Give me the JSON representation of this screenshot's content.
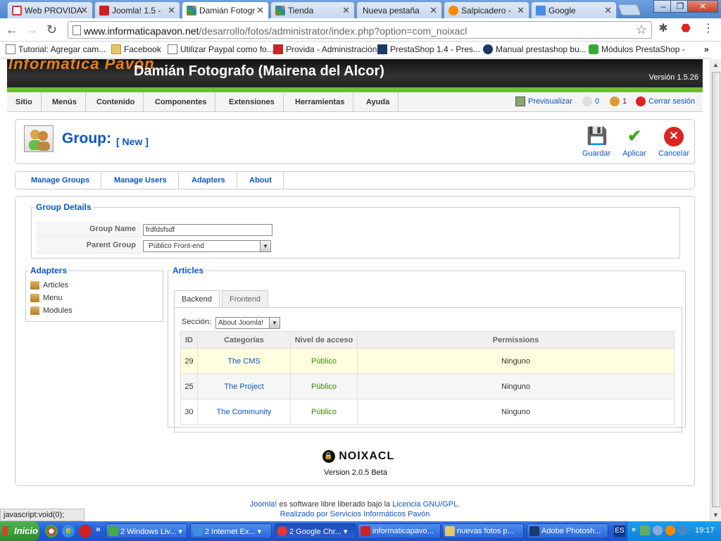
{
  "browser": {
    "tabs": [
      {
        "label": "Web PROVIDA",
        "color": "#d33"
      },
      {
        "label": "Joomla! 1.5 -",
        "color": "#c22"
      },
      {
        "label": "Damián Fotogr",
        "color": "#333",
        "active": true
      },
      {
        "label": "Tienda",
        "color": "#333"
      },
      {
        "label": "Nueva pestaña",
        "color": "#fff"
      },
      {
        "label": "Salpicadero -",
        "color": "#f80"
      },
      {
        "label": "Google",
        "color": "#4a8ae8"
      }
    ],
    "url_host": "www.informaticapavon.net",
    "url_path": "/desarrollo/fotos/administrator/index.php?option=com_noixacl",
    "bookmarks": [
      "Tutorial: Agregar cam...",
      "Facebook",
      "Utilizar Paypal como fo...",
      "Provida - Administración",
      "PrestaShop 1.4 - Pres...",
      "Manual prestashop bu...",
      "Módulos PrestaShop -"
    ],
    "bookmarks_more": "»"
  },
  "site": {
    "logo": "Informatica Pavón",
    "title": "Damián Fotografo (Mairena del Alcor)",
    "version": "Versión 1.5.26"
  },
  "menu": [
    "Sitio",
    "Menús",
    "Contenido",
    "Componentes",
    "Extensiones",
    "Herramientas",
    "Ayuda"
  ],
  "status": {
    "preview": "Previsualizar",
    "messages": "0",
    "users": "1",
    "logout": "Cerrar sesión"
  },
  "toolbar": {
    "title": "Group:",
    "subtitle": "[ New ]",
    "save": "Guardar",
    "apply": "Aplicar",
    "cancel": "Cancelar"
  },
  "submenu": [
    "Manage Groups",
    "Manage Users",
    "Adapters",
    "About"
  ],
  "group_details": {
    "legend": "Group Details",
    "name_label": "Group Name",
    "name_value": "frdfdsfsdf",
    "parent_label": "Parent Group",
    "parent_value": "Público Front-end"
  },
  "adapters": {
    "legend": "Adapters",
    "items": [
      "Articles",
      "Menu",
      "Modules"
    ]
  },
  "articles": {
    "legend": "Articles",
    "tabs": [
      "Backend",
      "Frontend"
    ],
    "section_label": "Sección:",
    "section_value": "About Joomla!",
    "columns": [
      "ID",
      "Categorías",
      "Nivel de acceso",
      "Permissions"
    ],
    "rows": [
      {
        "id": "29",
        "category": "The CMS",
        "access": "Público",
        "perm": "Ninguno"
      },
      {
        "id": "25",
        "category": "The Project",
        "access": "Público",
        "perm": "Ninguno"
      },
      {
        "id": "30",
        "category": "The Community",
        "access": "Público",
        "perm": "Ninguno"
      }
    ]
  },
  "brand": {
    "name": "NOIXACL",
    "version": "Version 2.0.5 Beta"
  },
  "footer": {
    "line1_link": "Joomla!",
    "line1_text": " es software libre liberado bajo la ",
    "line1_license": "Licencia GNU/GPL",
    "line2": "Realizado por Servicios Informáticos Pavón"
  },
  "statusbar": "javascript:void(0);",
  "taskbar": {
    "start": "Inicio",
    "tasks": [
      "2 Windows Liv...",
      "2 Internet Ex...",
      "2 Google Chr...",
      "informaticapavo...",
      "nuevas fotos p...",
      "Adobe Photosh..."
    ],
    "lang": "ES",
    "clock": "19:17"
  }
}
